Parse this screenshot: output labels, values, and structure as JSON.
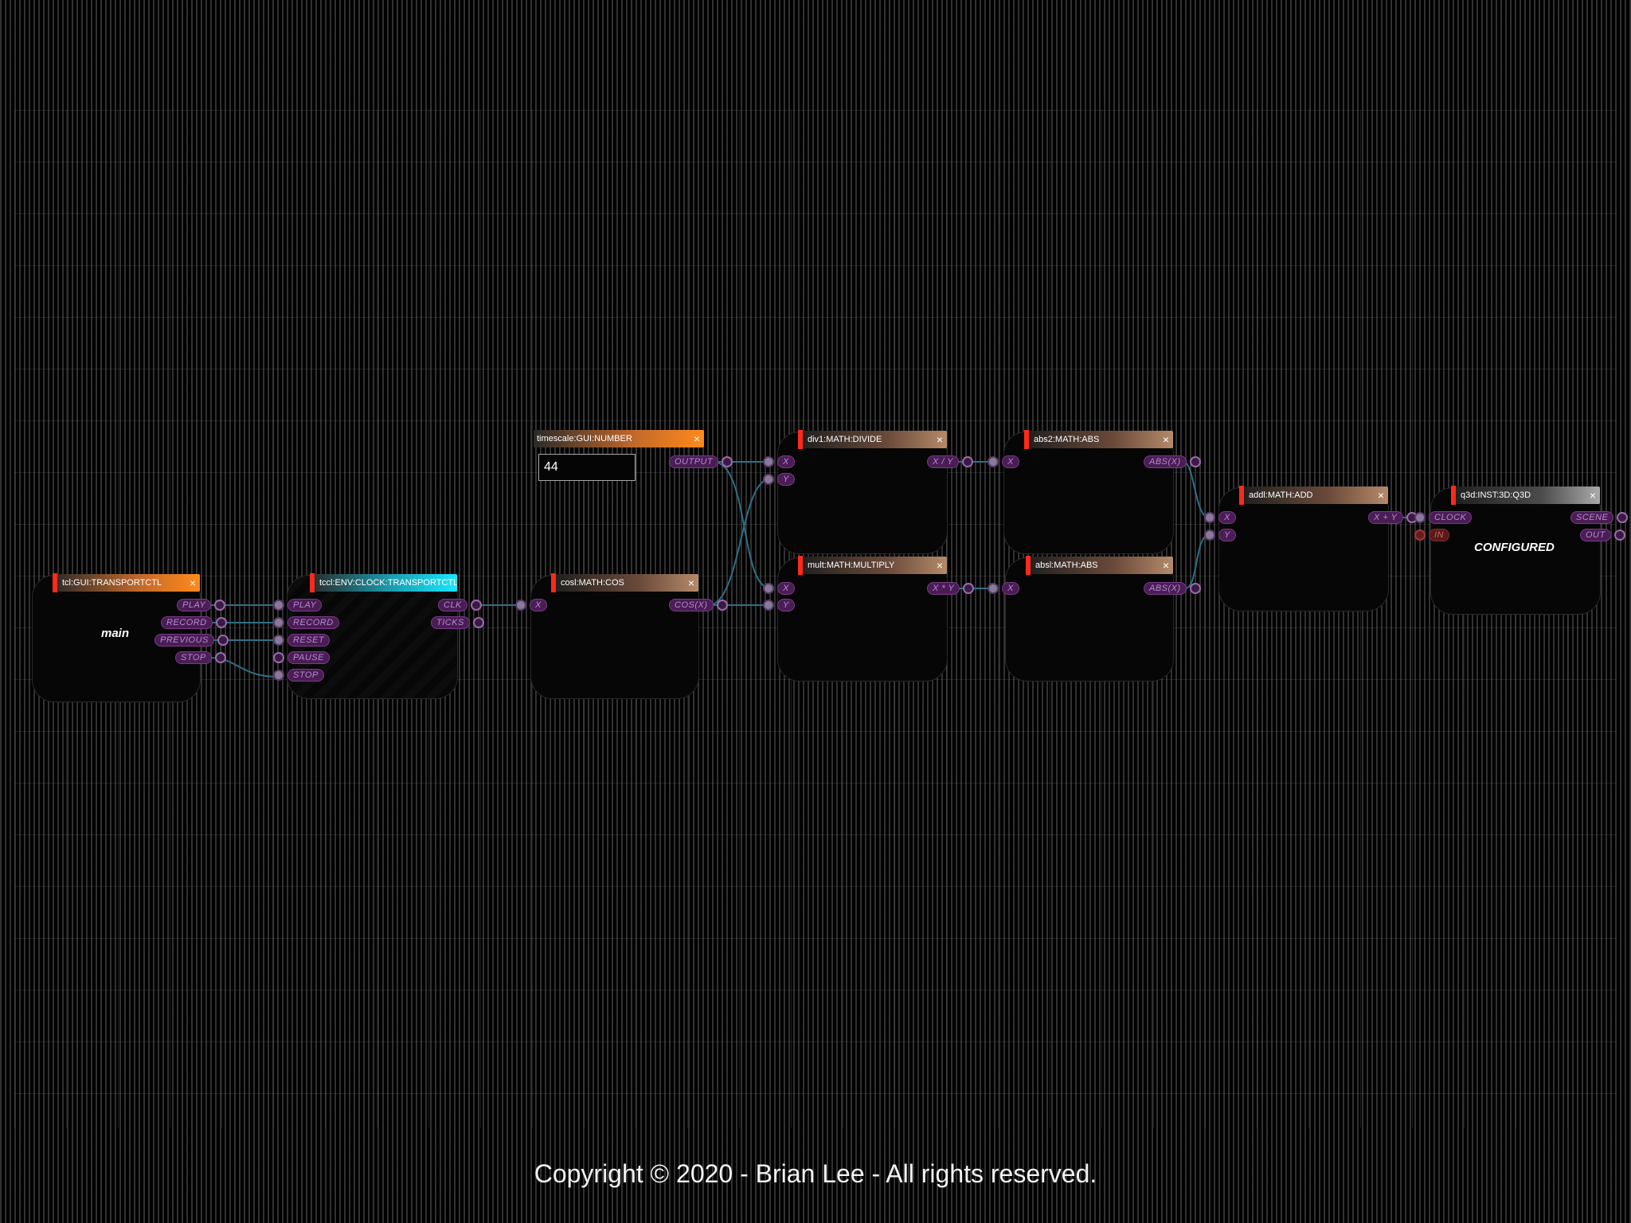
{
  "nodes": {
    "transport": {
      "title": "tcl:GUI:TRANSPORTCTL",
      "label": "main",
      "outputs": [
        "PLAY",
        "RECORD",
        "PREVIOUS",
        "STOP"
      ]
    },
    "clock": {
      "title": "tccl:ENV:CLOCK:TRANSPORTCTL",
      "inputs": [
        "PLAY",
        "RECORD",
        "RESET",
        "PAUSE",
        "STOP"
      ],
      "outputs": [
        "CLK",
        "TICKS"
      ]
    },
    "timescale": {
      "title": "timescale:GUI:NUMBER",
      "value": "44",
      "outputs": [
        "OUTPUT"
      ]
    },
    "cos": {
      "title": "cosl:MATH:COS",
      "inputs": [
        "X"
      ],
      "outputs": [
        "COS(X)"
      ]
    },
    "divide": {
      "title": "div1:MATH:DIVIDE",
      "inputs": [
        "X",
        "Y"
      ],
      "outputs": [
        "X / Y"
      ]
    },
    "multiply": {
      "title": "mult:MATH:MULTIPLY",
      "inputs": [
        "X",
        "Y"
      ],
      "outputs": [
        "X * Y"
      ]
    },
    "abs2": {
      "title": "abs2:MATH:ABS",
      "inputs": [
        "X"
      ],
      "outputs": [
        "ABS(X)"
      ]
    },
    "abs1": {
      "title": "absl:MATH:ABS",
      "inputs": [
        "X"
      ],
      "outputs": [
        "ABS(X)"
      ]
    },
    "add": {
      "title": "addl:MATH:ADD",
      "inputs": [
        "X",
        "Y"
      ],
      "outputs": [
        "X + Y"
      ]
    },
    "q3d": {
      "title": "q3d:INST:3D:Q3D",
      "label": "CONFIGURED",
      "inputs": [
        "CLOCK",
        "IN"
      ],
      "outputs": [
        "SCENE",
        "OUT"
      ]
    }
  },
  "close_glyph": "×",
  "footer": "Copyright © 2020 - Brian Lee - All rights reserved.",
  "colors": {
    "wire": "#2f6f86",
    "accent": "#ff2a1a",
    "port": "#4a1d55"
  }
}
